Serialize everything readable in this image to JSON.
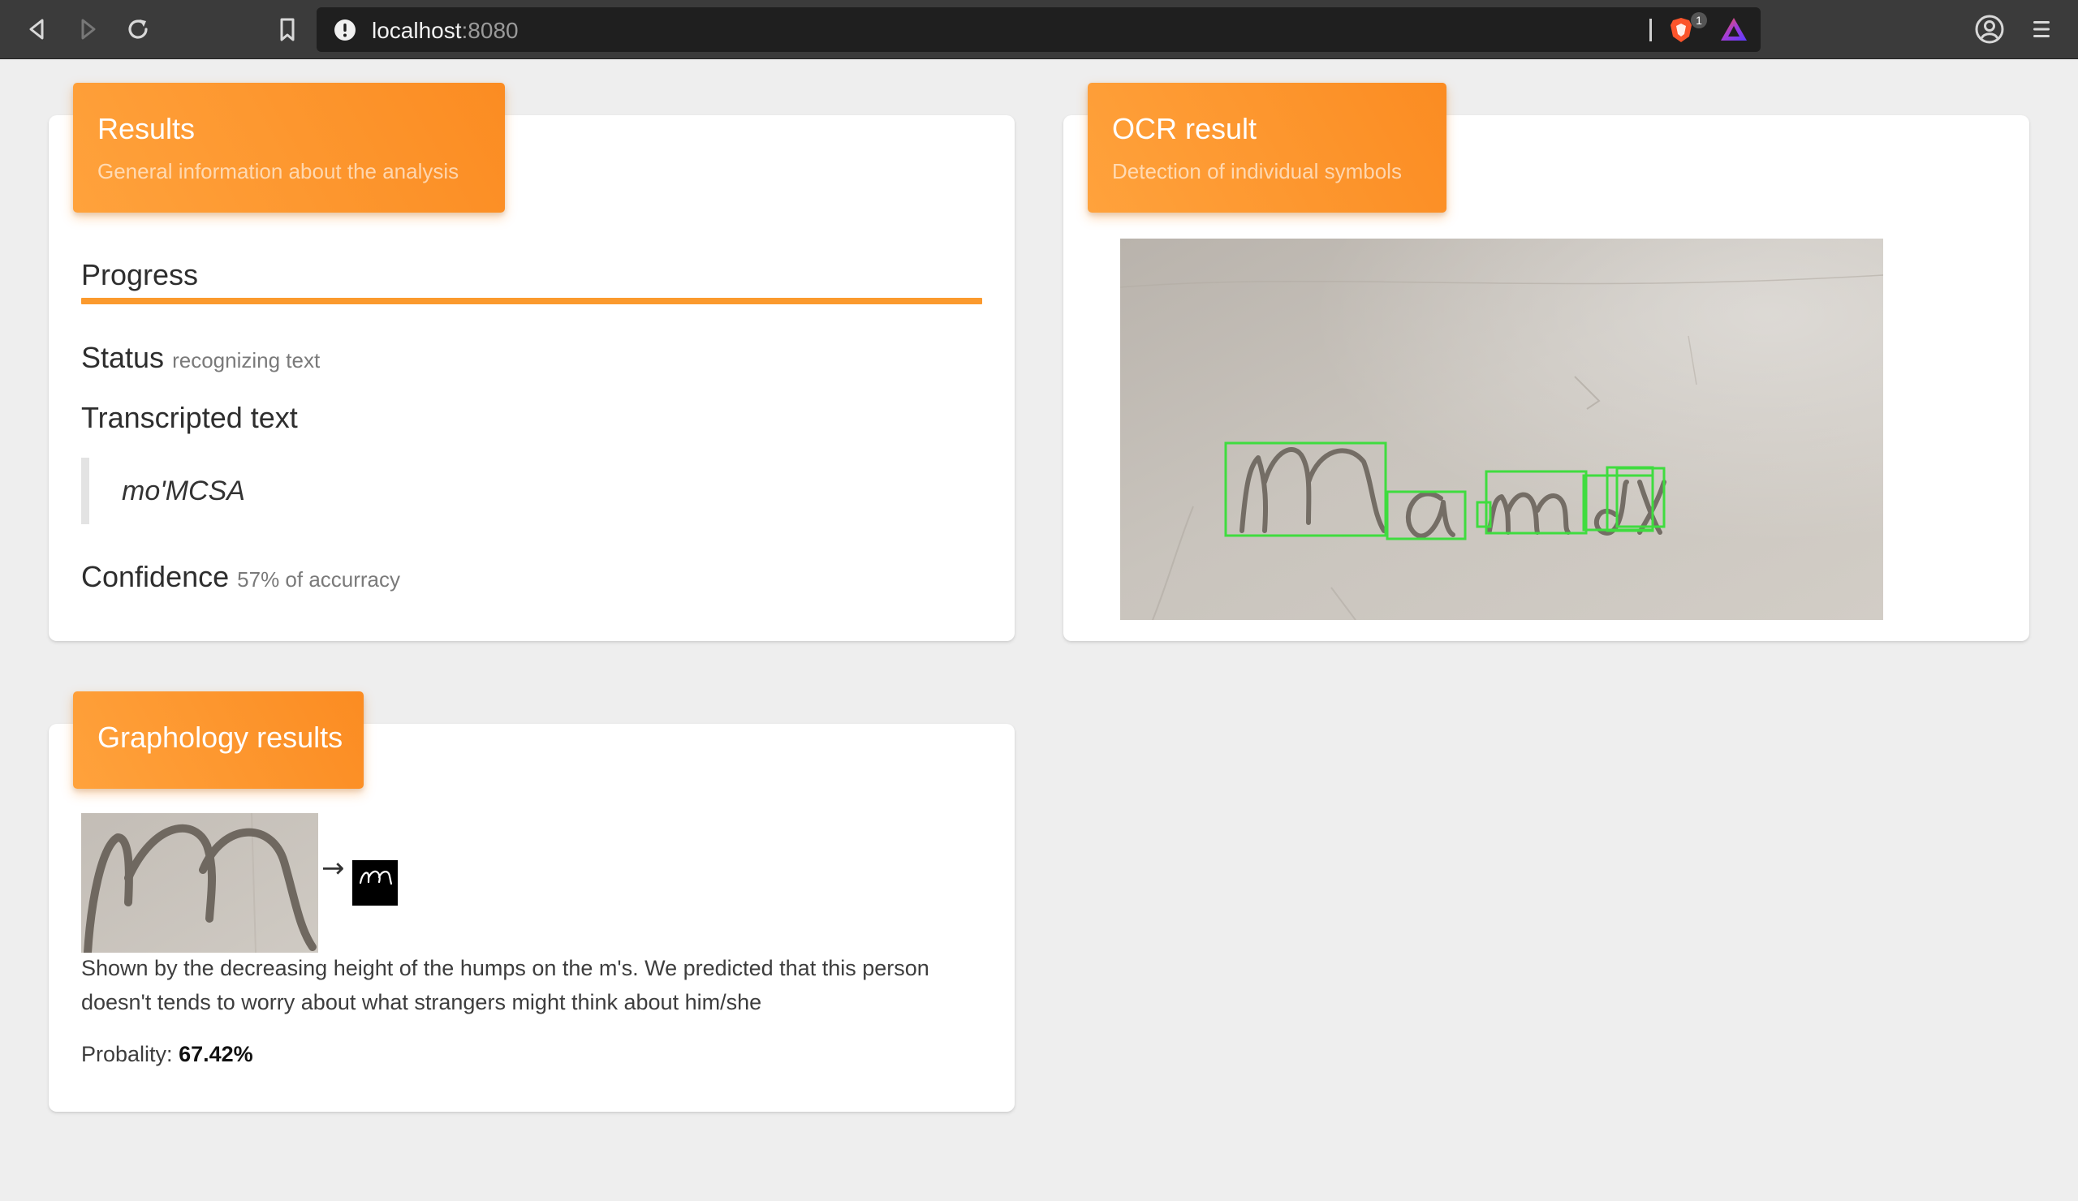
{
  "browser": {
    "url_host": "localhost",
    "url_port": ":8080",
    "shields_count": "1"
  },
  "results_card": {
    "title": "Results",
    "subtitle": "General information about the analysis",
    "progress_label": "Progress",
    "progress_fraction": 1.0,
    "status_label": "Status",
    "status_value": "recognizing text",
    "transcripted_label": "Transcripted text",
    "transcripted_value": "mo'MCSA",
    "confidence_label": "Confidence",
    "confidence_value": "57% of accurracy"
  },
  "ocr_card": {
    "title": "OCR result",
    "subtitle": "Detection of individual symbols",
    "box_color": "#3fdc3f"
  },
  "graphology_card": {
    "title": "Graphology results",
    "arrow": "→",
    "description": "Shown by the decreasing height of the humps on the m's. We predicted that this person doesn't tends to worry about what strangers might think about him/she",
    "probability_label": "Probality:",
    "probability_value": "67.42%"
  },
  "colors": {
    "accent": "#fb8c22",
    "toolbar": "#3b3b3b",
    "background": "#eeeeee"
  }
}
